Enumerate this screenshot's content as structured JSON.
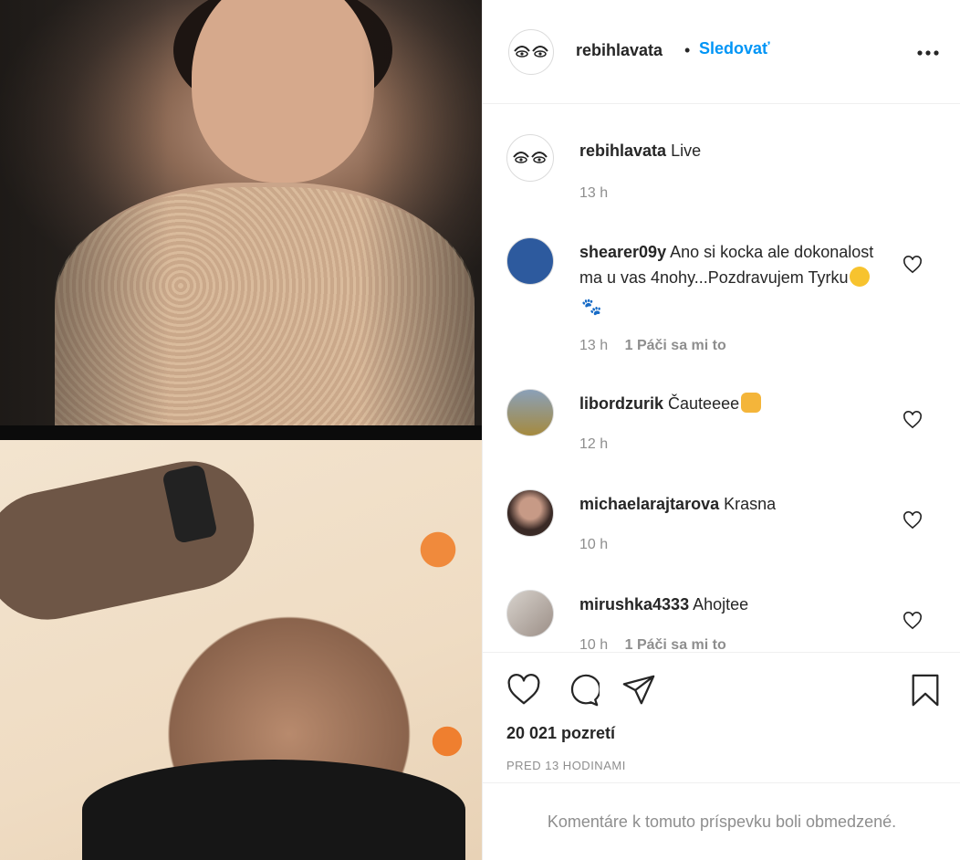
{
  "post_owner": {
    "username": "rebihlavata",
    "separator": "•",
    "follow_label": "Sledovať"
  },
  "caption": {
    "username": "rebihlavata",
    "text": "Live",
    "time": "13 h"
  },
  "comments": [
    {
      "username": "shearer09y",
      "text": "Ano si kocka ale dokonalost ma u vas 4nohy...Pozdravujem Tyrku",
      "emoji": [
        "winking-face-kiss",
        "paw-prints"
      ],
      "time": "13 h",
      "likes": "1 Páči sa mi to"
    },
    {
      "username": "libordzurik",
      "text": "Čauteeee",
      "emoji": [
        "raising-hands"
      ],
      "time": "12 h",
      "likes": ""
    },
    {
      "username": "michaelarajtarova",
      "text": "Krasna",
      "time": "10 h",
      "likes": ""
    },
    {
      "username": "mirushka4333",
      "text": "Ahojtee",
      "time": "10 h",
      "likes": "1 Páči sa mi to"
    }
  ],
  "stats": {
    "views": "20 021 pozretí",
    "posted": "PRED 13 HODINAMI"
  },
  "comments_restricted": "Komentáre k tomuto príspevku boli obmedzené.",
  "icons": {
    "like": "heart-icon",
    "comment": "comment-icon",
    "share": "paper-plane-icon",
    "save": "bookmark-icon",
    "more": "more-options-icon"
  },
  "colors": {
    "link": "#0095f6",
    "muted": "#8e8e8e",
    "text": "#262626",
    "border": "#efefef"
  }
}
